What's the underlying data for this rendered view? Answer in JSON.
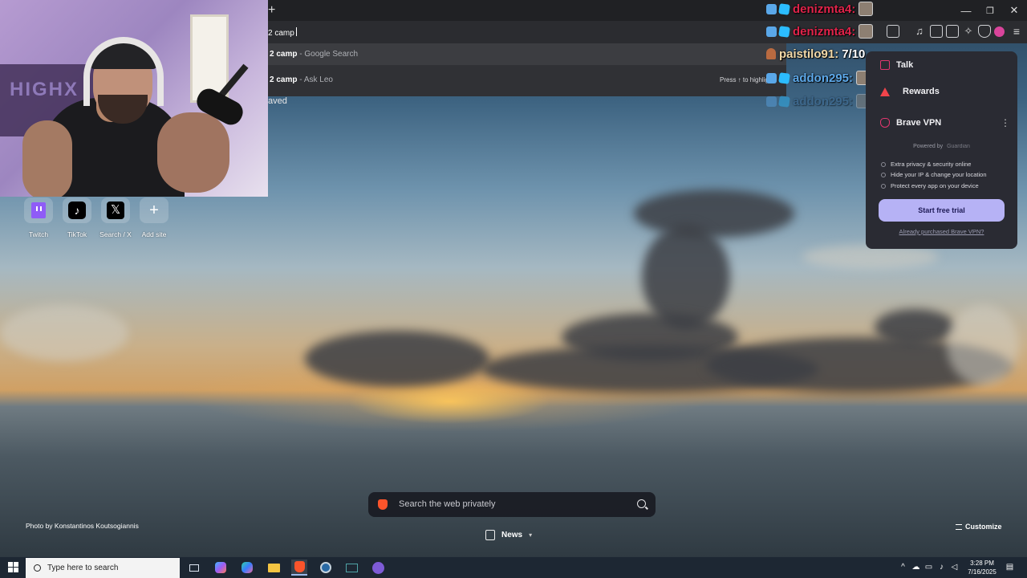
{
  "tabstrip": {
    "new_tab_glyph": "+"
  },
  "window_controls": {
    "minimize": "—",
    "restore": "❐",
    "close": "✕"
  },
  "omnibox": {
    "typed_text": "2 camp"
  },
  "suggestions": [
    {
      "query": "2 camp",
      "source": "Google Search",
      "separator": " - "
    },
    {
      "query": "2 camp",
      "source": "Ask Leo",
      "separator": " - "
    }
  ],
  "suggestion_hint": "Press ↑ to highlig",
  "partial_text": "aved",
  "chat": [
    {
      "user": "denizmta4:",
      "message": "",
      "color": "#e0234a"
    },
    {
      "user": "denizmta4:",
      "message": "",
      "color": "#e0234a"
    },
    {
      "user": "paistilo91:",
      "message": "7/10",
      "color": "#f2d9a8"
    },
    {
      "user": "addon295:",
      "message": "",
      "color": "#5da9ea"
    },
    {
      "user": "addon295:",
      "message": "",
      "color": "#3c6c99"
    }
  ],
  "brave_panel": {
    "talk": "Talk",
    "rewards": "Rewards",
    "vpn_title": "Brave VPN",
    "powered_by": "Powered by",
    "powered_brand": "Guardian",
    "features": [
      "Extra privacy & security online",
      "Hide your IP & change your location",
      "Protect every app on your device"
    ],
    "trial_button": "Start free trial",
    "already_purchased": "Already purchased Brave VPN?"
  },
  "top_sites": [
    {
      "label": "Twitch",
      "icon": "twitch-icon"
    },
    {
      "label": "TikTok",
      "icon": "tiktok-icon"
    },
    {
      "label": "Search / X",
      "icon": "x-icon"
    },
    {
      "label": "Add site",
      "icon": "plus-icon"
    }
  ],
  "search": {
    "placeholder": "Search the web privately"
  },
  "photo_credit": "Photo by Konstantinos Koutsogiannis",
  "news_label": "News",
  "customize_label": "Customize",
  "taskbar": {
    "search_placeholder": "Type here to search",
    "time": "3:28 PM",
    "date": "7/16/2025"
  },
  "webcam": {
    "poster_text": "HIGHX"
  },
  "colors": {
    "brave_orange": "#fb542b",
    "vpn_button": "#b6b2f5",
    "panel_bg": "#2a2b33"
  }
}
